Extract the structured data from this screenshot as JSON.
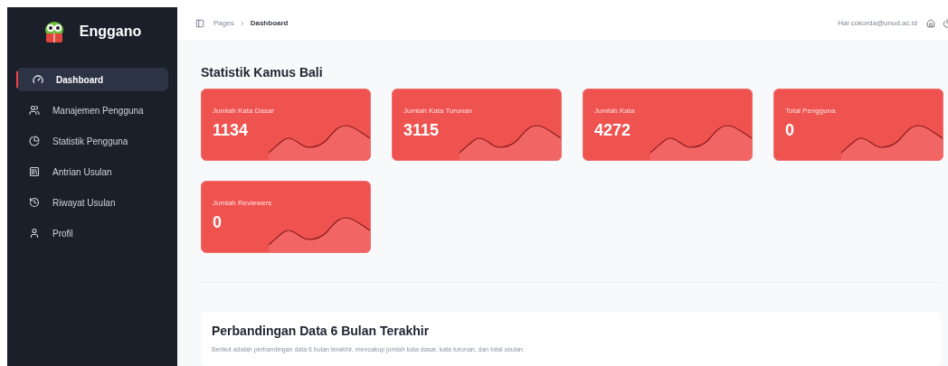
{
  "sidebar": {
    "brand": "Enggano",
    "items": [
      {
        "label": "Dashboard",
        "selected": true
      },
      {
        "label": "Manajemen Pengguna",
        "selected": false
      },
      {
        "label": "Statistik Pengguna",
        "selected": false
      },
      {
        "label": "Antrian Usulan",
        "selected": false
      },
      {
        "label": "Riwayat Usulan",
        "selected": false
      },
      {
        "label": "Profil",
        "selected": false
      }
    ]
  },
  "topbar": {
    "breadcrumb": [
      "Pages",
      "Dashboard"
    ],
    "greeting": "Hai cokorda@unud.ac.id"
  },
  "stats": {
    "title": "Statistik Kamus Bali",
    "cards": [
      {
        "label": "Jumlah Kata Dasar",
        "value": "1134"
      },
      {
        "label": "Jumlah Kata Turunan",
        "value": "3115"
      },
      {
        "label": "Jumlah Kata",
        "value": "4272"
      },
      {
        "label": "Total Pengguna",
        "value": "0"
      },
      {
        "label": "Jumlah Reviewers",
        "value": "0"
      }
    ]
  },
  "comparison": {
    "title": "Perbandingan Data 6 Bulan Terakhir",
    "description": "Berikut adalah perbandingan data 6 bulan terakhir, mencakup jumlah kata dasar, kata turunan, dan total usulan."
  }
}
